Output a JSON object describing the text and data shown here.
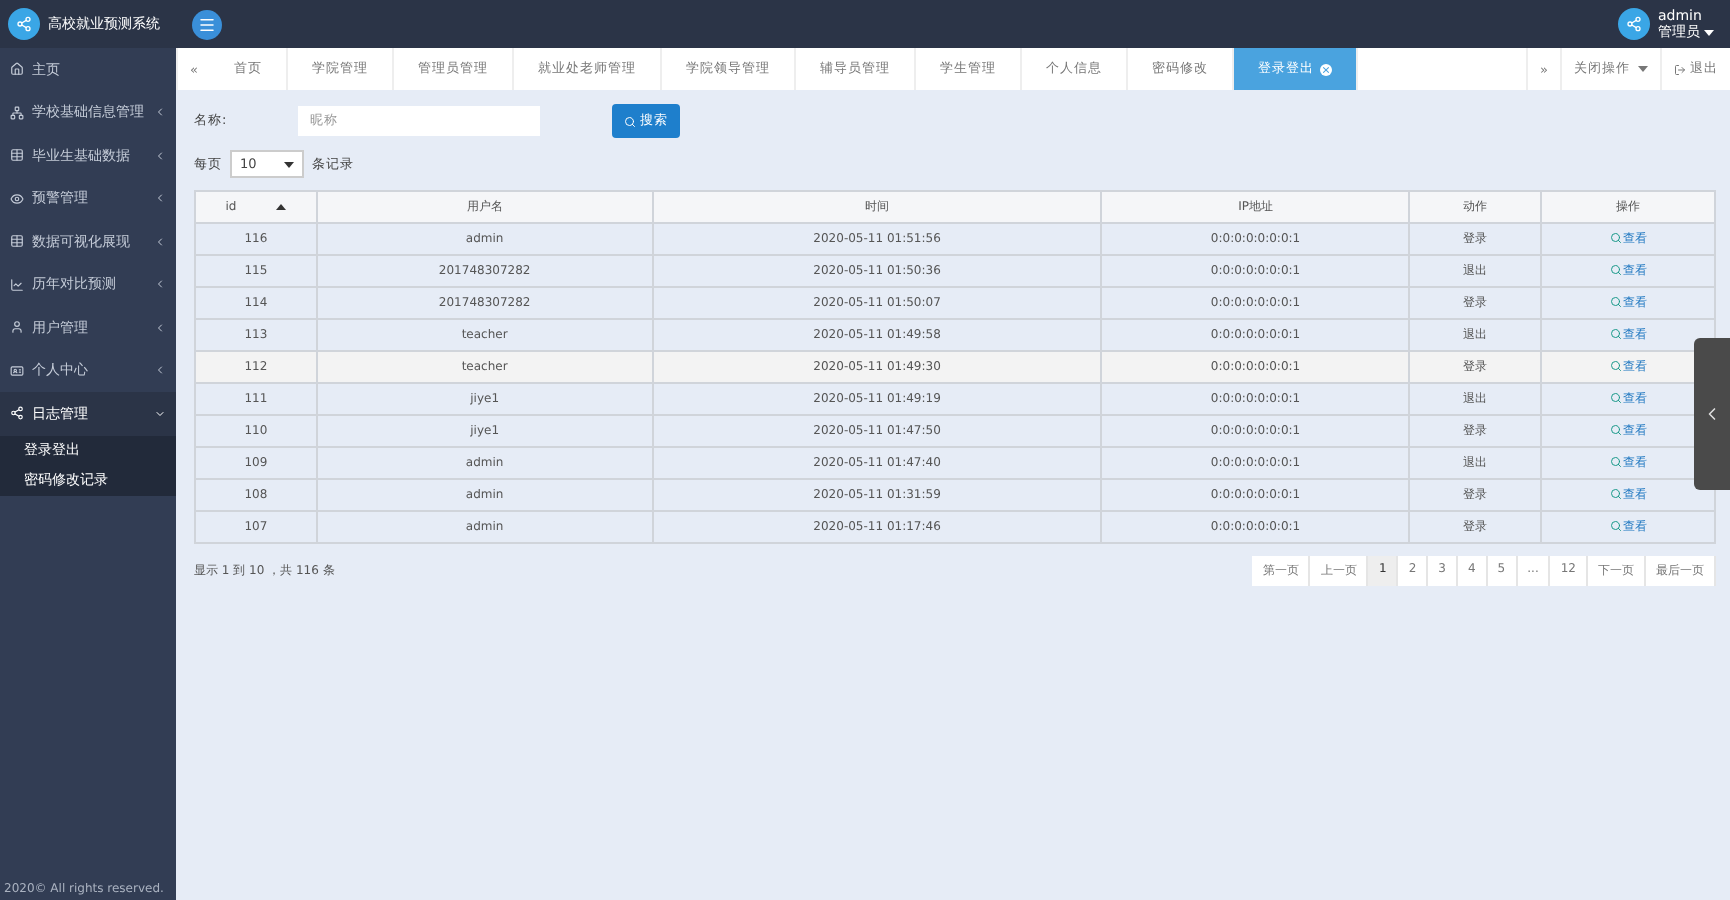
{
  "sidebar": {
    "title": "高校就业预测系统",
    "items": [
      {
        "label": "主页",
        "expanded": false
      },
      {
        "label": "学校基础信息管理",
        "expanded": false
      },
      {
        "label": "毕业生基础数据",
        "expanded": false
      },
      {
        "label": "预警管理",
        "expanded": false
      },
      {
        "label": "数据可视化展现",
        "expanded": false
      },
      {
        "label": "历年对比预测",
        "expanded": false
      },
      {
        "label": "用户管理",
        "expanded": false
      },
      {
        "label": "个人中心",
        "expanded": false
      },
      {
        "label": "日志管理",
        "expanded": true,
        "children": [
          {
            "label": "登录登出"
          },
          {
            "label": "密码修改记录"
          }
        ]
      }
    ],
    "footer": "2020© All rights reserved."
  },
  "user": {
    "name": "admin",
    "role": "管理员"
  },
  "tabs": [
    {
      "label": "首页",
      "selected": false
    },
    {
      "label": "学院管理",
      "selected": false
    },
    {
      "label": "管理员管理",
      "selected": false
    },
    {
      "label": "就业处老师管理",
      "selected": false
    },
    {
      "label": "学院领导管理",
      "selected": false
    },
    {
      "label": "辅导员管理",
      "selected": false
    },
    {
      "label": "学生管理",
      "selected": false
    },
    {
      "label": "个人信息",
      "selected": false
    },
    {
      "label": "密码修改",
      "selected": false
    },
    {
      "label": "登录登出",
      "selected": true
    }
  ],
  "tab_nav": {
    "prev": "«",
    "next": "»",
    "close_menu": "关闭操作",
    "logout": "退出"
  },
  "filter": {
    "label": "名称:",
    "placeholder": "昵称",
    "button": "搜索"
  },
  "page_size": {
    "before": "每页",
    "value": "10",
    "after": "条记录"
  },
  "table": {
    "columns": [
      "id",
      "用户名",
      "时间",
      "IP地址",
      "动作",
      "操作"
    ],
    "rows": [
      {
        "id": "116",
        "user": "admin",
        "time": "2020-05-11 01:51:56",
        "ip": "0:0:0:0:0:0:0:1",
        "action": "登录",
        "op": "查看",
        "selected": false
      },
      {
        "id": "115",
        "user": "201748307282",
        "time": "2020-05-11 01:50:36",
        "ip": "0:0:0:0:0:0:0:1",
        "action": "退出",
        "op": "查看",
        "selected": false
      },
      {
        "id": "114",
        "user": "201748307282",
        "time": "2020-05-11 01:50:07",
        "ip": "0:0:0:0:0:0:0:1",
        "action": "登录",
        "op": "查看",
        "selected": false
      },
      {
        "id": "113",
        "user": "teacher",
        "time": "2020-05-11 01:49:58",
        "ip": "0:0:0:0:0:0:0:1",
        "action": "退出",
        "op": "查看",
        "selected": false
      },
      {
        "id": "112",
        "user": "teacher",
        "time": "2020-05-11 01:49:30",
        "ip": "0:0:0:0:0:0:0:1",
        "action": "登录",
        "op": "查看",
        "selected": true
      },
      {
        "id": "111",
        "user": "jiye1",
        "time": "2020-05-11 01:49:19",
        "ip": "0:0:0:0:0:0:0:1",
        "action": "退出",
        "op": "查看",
        "selected": false
      },
      {
        "id": "110",
        "user": "jiye1",
        "time": "2020-05-11 01:47:50",
        "ip": "0:0:0:0:0:0:0:1",
        "action": "登录",
        "op": "查看",
        "selected": false
      },
      {
        "id": "109",
        "user": "admin",
        "time": "2020-05-11 01:47:40",
        "ip": "0:0:0:0:0:0:0:1",
        "action": "退出",
        "op": "查看",
        "selected": false
      },
      {
        "id": "108",
        "user": "admin",
        "time": "2020-05-11 01:31:59",
        "ip": "0:0:0:0:0:0:0:1",
        "action": "登录",
        "op": "查看",
        "selected": false
      },
      {
        "id": "107",
        "user": "admin",
        "time": "2020-05-11 01:17:46",
        "ip": "0:0:0:0:0:0:0:1",
        "action": "登录",
        "op": "查看",
        "selected": false
      }
    ]
  },
  "summary": "显示 1 到 10 ，共 116 条",
  "pagination": [
    {
      "label": "第一页",
      "selected": false
    },
    {
      "label": "上一页",
      "selected": false
    },
    {
      "label": "1",
      "selected": true
    },
    {
      "label": "2",
      "selected": false
    },
    {
      "label": "3",
      "selected": false
    },
    {
      "label": "4",
      "selected": false
    },
    {
      "label": "5",
      "selected": false
    },
    {
      "label": "...",
      "selected": false
    },
    {
      "label": "12",
      "selected": false
    },
    {
      "label": "下一页",
      "selected": false
    },
    {
      "label": "最后一页",
      "selected": false
    }
  ]
}
